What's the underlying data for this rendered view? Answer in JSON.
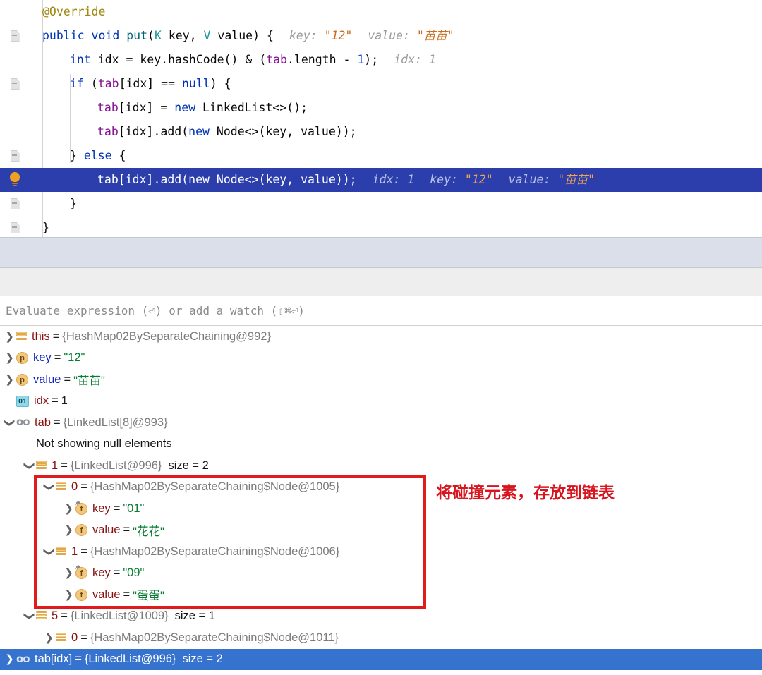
{
  "editor": {
    "lines": [
      {
        "indent": 0,
        "gutter": "none",
        "tokens": [
          {
            "t": "@Override",
            "c": "ann"
          }
        ]
      },
      {
        "indent": 0,
        "gutter": "fold",
        "tokens": [
          {
            "t": "public",
            "c": "kw"
          },
          {
            "t": " ",
            "c": "pln"
          },
          {
            "t": "void",
            "c": "kw"
          },
          {
            "t": " ",
            "c": "pln"
          },
          {
            "t": "put",
            "c": "meth"
          },
          {
            "t": "(",
            "c": "pln"
          },
          {
            "t": "K",
            "c": "typ"
          },
          {
            "t": " key, ",
            "c": "pln"
          },
          {
            "t": "V",
            "c": "typ"
          },
          {
            "t": " value) {",
            "c": "pln"
          },
          {
            "t": "sp",
            "c": "hsp"
          },
          {
            "t": "key:",
            "c": "hint-lbl"
          },
          {
            "t": " ",
            "c": "pln"
          },
          {
            "t": "\"12\"",
            "c": "hint-val"
          },
          {
            "t": "sp",
            "c": "hsp"
          },
          {
            "t": "value:",
            "c": "hint-lbl"
          },
          {
            "t": " ",
            "c": "pln"
          },
          {
            "t": "\"苗苗\"",
            "c": "hint-val"
          }
        ]
      },
      {
        "indent": 1,
        "gutter": "none",
        "tokens": [
          {
            "t": "int",
            "c": "kw"
          },
          {
            "t": " idx = key.hashCode() & (",
            "c": "pln"
          },
          {
            "t": "tab",
            "c": "fld"
          },
          {
            "t": ".length - ",
            "c": "pln"
          },
          {
            "t": "1",
            "c": "num"
          },
          {
            "t": ");",
            "c": "pln"
          },
          {
            "t": "sp",
            "c": "hsp"
          },
          {
            "t": "idx:",
            "c": "hint-lbl"
          },
          {
            "t": " ",
            "c": "pln"
          },
          {
            "t": "1",
            "c": "hint-lbl"
          }
        ]
      },
      {
        "indent": 1,
        "gutter": "fold",
        "tokens": [
          {
            "t": "if",
            "c": "kw"
          },
          {
            "t": " (",
            "c": "pln"
          },
          {
            "t": "tab",
            "c": "fld"
          },
          {
            "t": "[idx] == ",
            "c": "pln"
          },
          {
            "t": "null",
            "c": "kw"
          },
          {
            "t": ") {",
            "c": "pln"
          }
        ]
      },
      {
        "indent": 2,
        "gutter": "none",
        "tokens": [
          {
            "t": "tab",
            "c": "fld"
          },
          {
            "t": "[idx] = ",
            "c": "pln"
          },
          {
            "t": "new",
            "c": "kw"
          },
          {
            "t": " LinkedList<>();",
            "c": "pln"
          }
        ]
      },
      {
        "indent": 2,
        "gutter": "none",
        "tokens": [
          {
            "t": "tab",
            "c": "fld"
          },
          {
            "t": "[idx].add(",
            "c": "pln"
          },
          {
            "t": "new",
            "c": "kw"
          },
          {
            "t": " Node<>(key, value));",
            "c": "pln"
          }
        ]
      },
      {
        "indent": 1,
        "gutter": "fold",
        "tokens": [
          {
            "t": "} ",
            "c": "pln"
          },
          {
            "t": "else",
            "c": "kw"
          },
          {
            "t": " {",
            "c": "pln"
          }
        ]
      },
      {
        "indent": 2,
        "gutter": "bulb",
        "highlight": true,
        "tokens": [
          {
            "t": "tab",
            "c": "fld"
          },
          {
            "t": "[idx].add(",
            "c": "pln"
          },
          {
            "t": "new",
            "c": "kw"
          },
          {
            "t": " Node<>(key, value));",
            "c": "pln"
          },
          {
            "t": "sp",
            "c": "hsp"
          },
          {
            "t": "idx:",
            "c": "hint-lbl"
          },
          {
            "t": " ",
            "c": "pln"
          },
          {
            "t": "1",
            "c": "hint-lbl"
          },
          {
            "t": "sp",
            "c": "hsp"
          },
          {
            "t": "key:",
            "c": "hint-lbl"
          },
          {
            "t": " ",
            "c": "pln"
          },
          {
            "t": "\"12\"",
            "c": "hint-val"
          },
          {
            "t": "sp",
            "c": "hsp"
          },
          {
            "t": "value:",
            "c": "hint-lbl"
          },
          {
            "t": " ",
            "c": "pln"
          },
          {
            "t": "\"苗苗\"",
            "c": "hint-val"
          }
        ]
      },
      {
        "indent": 1,
        "gutter": "fold",
        "tokens": [
          {
            "t": "}",
            "c": "pln"
          }
        ]
      },
      {
        "indent": 0,
        "gutter": "fold",
        "tokens": [
          {
            "t": "}",
            "c": "pln"
          }
        ]
      }
    ]
  },
  "evaluate": {
    "placeholder": "Evaluate expression (⏎) or add a watch (⇧⌘⏎)"
  },
  "variables": {
    "rows": [
      {
        "depth": 0,
        "arrow": "collapsed",
        "icon": "stack",
        "name": "this",
        "eq": "=",
        "ref": "{HashMap02BySeparateChaining@992}"
      },
      {
        "depth": 0,
        "arrow": "collapsed",
        "icon": "param",
        "icon_letter": "p",
        "name": "key",
        "name_kind": "param",
        "eq": "=",
        "str": "\"12\""
      },
      {
        "depth": 0,
        "arrow": "collapsed",
        "icon": "param",
        "icon_letter": "p",
        "name": "value",
        "name_kind": "param",
        "eq": "=",
        "str": "\"苗苗\""
      },
      {
        "depth": 0,
        "arrow": "none",
        "icon": "prim",
        "icon_letter": "01",
        "name": "idx",
        "eq": "=",
        "num": "1"
      },
      {
        "depth": 0,
        "arrow": "expanded",
        "icon": "array",
        "name": "tab",
        "eq": "=",
        "ref": "{LinkedList[8]@993}"
      },
      {
        "depth": 1,
        "arrow": "none",
        "icon": "none",
        "plain": "Not showing null elements"
      },
      {
        "depth": 1,
        "arrow": "expanded",
        "icon": "stack",
        "name": "1",
        "eq": "=",
        "ref": "{LinkedList@996}",
        "size": "size = 2"
      },
      {
        "depth": 2,
        "arrow": "expanded",
        "icon": "stack",
        "name": "0",
        "eq": "=",
        "ref": "{HashMap02BySeparateChaining$Node@1005}"
      },
      {
        "depth": 3,
        "arrow": "collapsed",
        "icon": "field",
        "icon_letter": "f",
        "pinned": true,
        "name": "key",
        "eq": "=",
        "str": "\"01\""
      },
      {
        "depth": 3,
        "arrow": "collapsed",
        "icon": "field",
        "icon_letter": "f",
        "name": "value",
        "eq": "=",
        "str": "\"花花\""
      },
      {
        "depth": 2,
        "arrow": "expanded",
        "icon": "stack",
        "name": "1",
        "eq": "=",
        "ref": "{HashMap02BySeparateChaining$Node@1006}"
      },
      {
        "depth": 3,
        "arrow": "collapsed",
        "icon": "field",
        "icon_letter": "f",
        "pinned": true,
        "name": "key",
        "eq": "=",
        "str": "\"09\""
      },
      {
        "depth": 3,
        "arrow": "collapsed",
        "icon": "field",
        "icon_letter": "f",
        "name": "value",
        "eq": "=",
        "str": "\"蛋蛋\""
      },
      {
        "depth": 1,
        "arrow": "expanded",
        "icon": "stack",
        "name": "5",
        "eq": "=",
        "ref": "{LinkedList@1009}",
        "size": "size = 1"
      },
      {
        "depth": 2,
        "arrow": "collapsed",
        "icon": "stack",
        "name": "0",
        "eq": "=",
        "ref": "{HashMap02BySeparateChaining$Node@1011}"
      },
      {
        "depth": 0,
        "arrow": "collapsed",
        "icon": "array",
        "selected": true,
        "name": "tab[idx]",
        "eq": "=",
        "ref": "{LinkedList@996}",
        "size": "size = 2"
      }
    ]
  },
  "annotation": {
    "text": "将碰撞元素，存放到链表",
    "color": "#d6151f"
  },
  "colors": {
    "highlight_line": "#2b3eab",
    "selected_row": "#3573cf",
    "annotation_red": "#e01b1b",
    "strip_blue": "#dbdfe9",
    "strip_gray": "#eeeeee"
  }
}
